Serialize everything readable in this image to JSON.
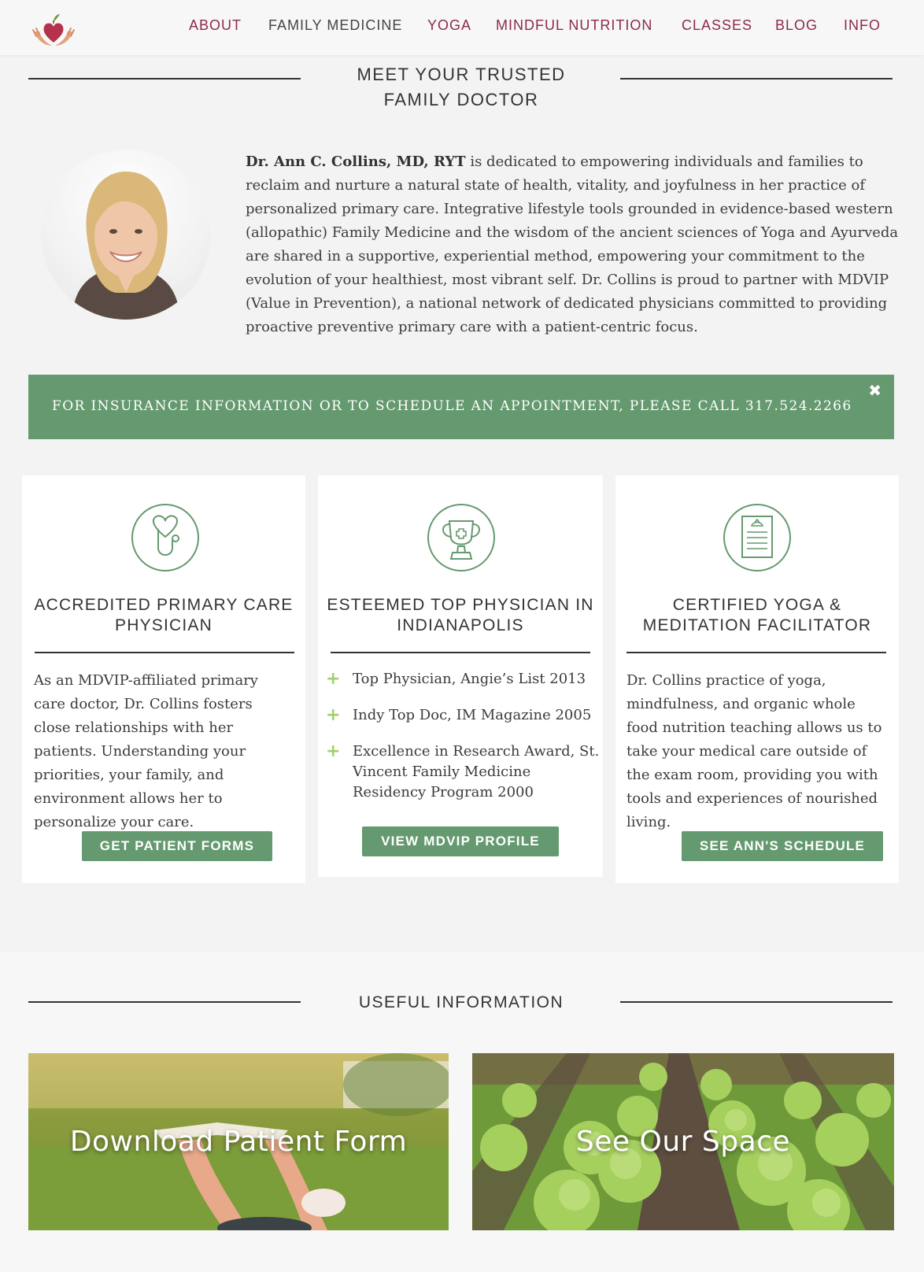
{
  "nav": {
    "items": [
      {
        "label": "ABOUT"
      },
      {
        "label": "FAMILY MEDICINE"
      },
      {
        "label": "YOGA"
      },
      {
        "label": "MINDFUL NUTRITION"
      },
      {
        "label": "CLASSES"
      },
      {
        "label": "BLOG"
      },
      {
        "label": "INFO"
      }
    ]
  },
  "intro": {
    "title_line1": "MEET YOUR TRUSTED",
    "title_line2": "FAMILY DOCTOR",
    "doctor_name": "Dr. Ann C. Collins, MD, RYT",
    "body": " is dedicated to empowering individuals and families to reclaim and nurture a natural state of health, vitality, and joyfulness in her practice of personalized primary care. Integrative lifestyle tools grounded in evidence-based western (allopathic) Family Medicine and the wisdom of the ancient sciences of Yoga and Ayurveda are shared in a supportive, experiential method, empowering your commitment to the evolution of your healthiest, most vibrant self. Dr. Collins is proud to partner with MDVIP (Value in Prevention), a national network of dedicated physicians committed to providing proactive preventive primary care with a patient-centric focus."
  },
  "banner": {
    "text": "FOR INSURANCE INFORMATION OR TO SCHEDULE AN APPOINTMENT, PLEASE CALL 317.524.2266",
    "close": "✖"
  },
  "cards": [
    {
      "icon": "stethoscope-icon",
      "title": "ACCREDITED PRIMARY CARE PHYSICIAN",
      "text": "As an MDVIP-affiliated primary care doctor, Dr. Collins fosters close relationships with her patients. Understanding your priorities, your family, and environment allows  her to personalize your care.",
      "button": "GET PATIENT FORMS"
    },
    {
      "icon": "trophy-icon",
      "title": "ESTEEMED TOP PHYSICIAN IN INDIANAPOLIS",
      "items": [
        "Top Physician, Angie’s List 2013",
        "Indy Top Doc, IM Magazine 2005",
        "Excellence in Research Award, St. Vincent Family Medicine Residency Program 2000"
      ],
      "button": "VIEW MDVIP PROFILE"
    },
    {
      "icon": "certificate-icon",
      "title": "CERTIFIED YOGA & MEDITATION FACILITATOR",
      "text": "Dr. Collins practice of yoga, mindfulness, and organic whole food nutrition teaching allows us to take your medical care outside of the exam room, providing you with tools and experiences of nourished living.",
      "button": "SEE ANN'S SCHEDULE"
    }
  ],
  "useful": {
    "title": "USEFUL INFORMATION",
    "tiles": [
      {
        "label": "Download Patient Form"
      },
      {
        "label": "See Our Space"
      }
    ]
  },
  "colors": {
    "brand_maroon": "#8e2a48",
    "brand_green": "#65996f",
    "plus_green": "#9fcf6f"
  }
}
